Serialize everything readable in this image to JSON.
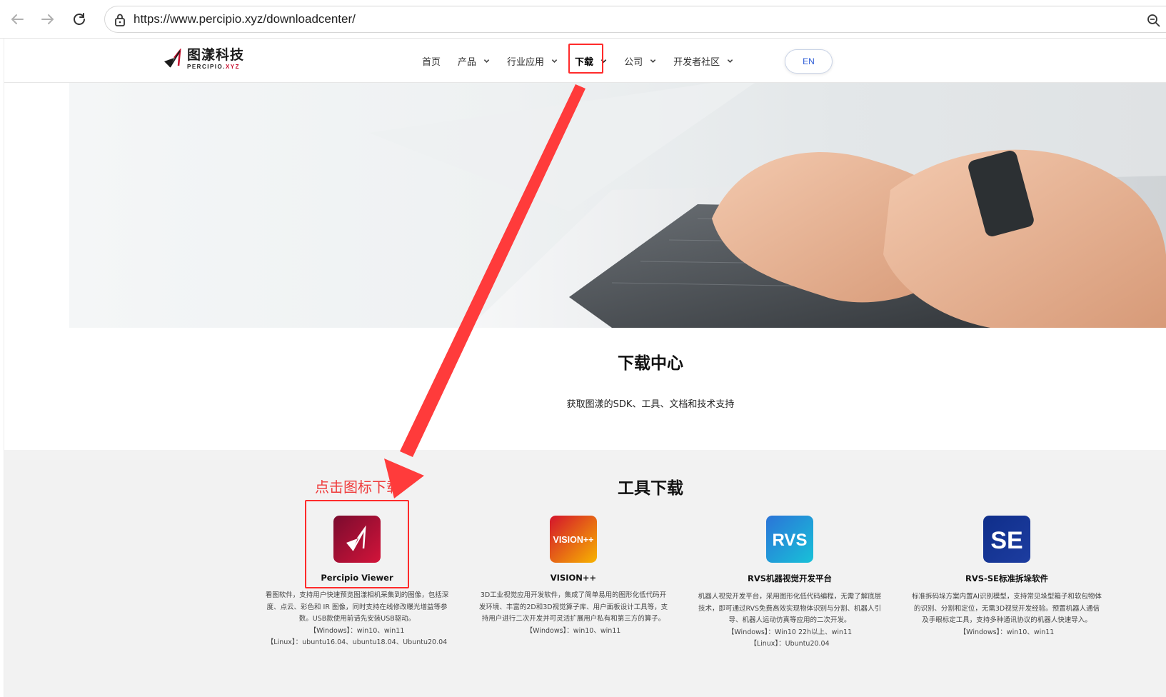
{
  "browser": {
    "url": "https://www.percipio.xyz/downloadcenter/",
    "icons": [
      "back-arrow-icon",
      "forward-arrow-icon",
      "reload-icon",
      "site-info-icon",
      "zoom-icon"
    ]
  },
  "header": {
    "logo_cn": "图漾科技",
    "logo_en_main": "PERCIPIO.",
    "logo_en_accent": "XYZ",
    "nav": [
      {
        "label": "首页",
        "dropdown": false
      },
      {
        "label": "产品",
        "dropdown": true
      },
      {
        "label": "行业应用",
        "dropdown": true
      },
      {
        "label": "下载",
        "dropdown": true
      },
      {
        "label": "公司",
        "dropdown": true
      },
      {
        "label": "开发者社区",
        "dropdown": true
      }
    ],
    "lang_button": "EN"
  },
  "hero": {
    "title": "下载中心",
    "subtitle": "获取图漾的SDK、工具、文档和技术支持"
  },
  "tools": {
    "section_title": "工具下载",
    "hint": "点击图标下载",
    "items": [
      {
        "name": "Percipio Viewer",
        "desc": [
          "看图软件，支持用户快速预览图漾相机采集到的图像，包括深",
          "度、点云、彩色和 IR 图像，同时支持在线修改曝光增益等参",
          "数。USB款使用前请先安装USB驱动。"
        ],
        "systems": [
          "【Windows】：win10、win11",
          "【Linux】：ubuntu16.04、ubuntu18.04、Ubuntu20.04"
        ],
        "icon_colors": [
          "#7a0b2e",
          "#d2143a"
        ]
      },
      {
        "name": "VISION++",
        "icon_text": "VISION++",
        "desc": [
          "3D工业视觉应用开发软件，集成了简单易用的图形化低代码开",
          "发环境、丰富的2D和3D视觉算子库、用户面板设计工具等，支",
          "持用户进行二次开发并可灵活扩展用户私有和第三方的算子。"
        ],
        "systems": [
          "【Windows】：win10、win11"
        ],
        "icon_colors": [
          "#d4142c",
          "#f7b400"
        ]
      },
      {
        "name": "RVS机器视觉开发平台",
        "icon_text": "RVS",
        "desc": [
          "机器人视觉开发平台，采用图形化低代码编程，无需了解底层",
          "技术，即可通过RVS免费高效实现物体识别与分割、机器人引",
          "导、机器人运动仿真等应用的二次开发。"
        ],
        "systems": [
          "【Windows】：Win10 22h以上、win11",
          "【Linux】：Ubuntu20.04"
        ],
        "icon_colors": [
          "#2b74d8",
          "#18c1d8"
        ]
      },
      {
        "name": "RVS-SE标准拆垛软件",
        "icon_text": "SE",
        "desc": [
          "标准拆码垛方案内置AI识别模型，支持常见垛型箱子和软包物体",
          "的识别、分割和定位，无需3D视觉开发经验。预置机器人通信",
          "及手眼标定工具，支持多种通讯协议的机器人快速导入。"
        ],
        "systems": [
          "【Windows】：win10、win11"
        ],
        "icon_colors": [
          "#0f2e8a",
          "#1d3da0"
        ]
      }
    ]
  },
  "annotation_color": "#ff2b2b"
}
